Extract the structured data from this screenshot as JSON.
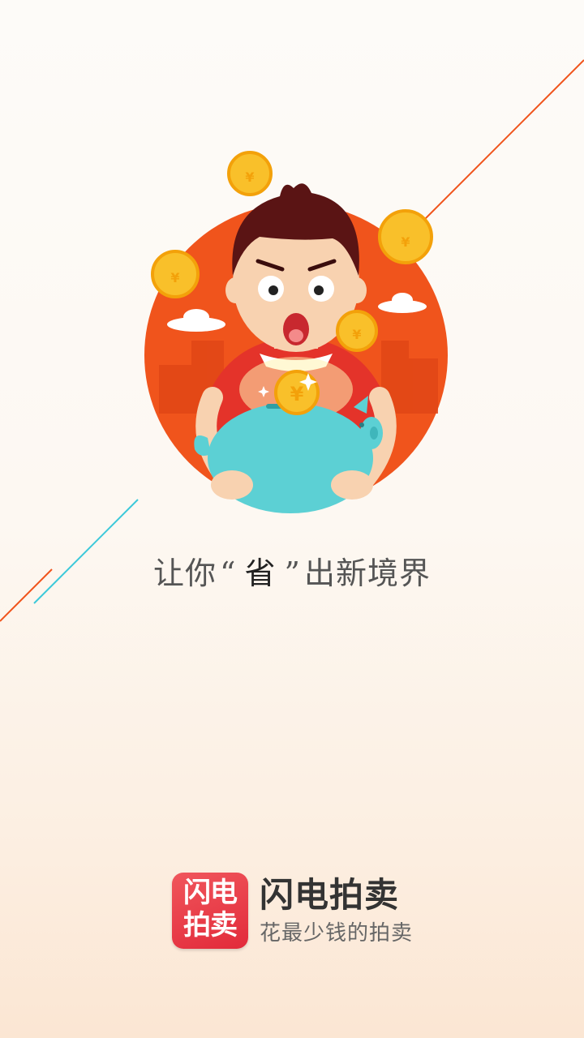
{
  "tagline": {
    "prefix": "让你",
    "open_quote": "“",
    "highlight": "省",
    "close_quote": "”",
    "suffix": "出新境界"
  },
  "brand": {
    "logo_line1": "闪电",
    "logo_line2": "拍卖",
    "name": "闪电拍卖",
    "slogan": "花最少钱的拍卖"
  },
  "illustration": {
    "icon": "piggy-bank-saver-illustration",
    "coin_symbol": "¥"
  },
  "colors": {
    "accent_orange": "#f0541c",
    "line_teal": "#3cc9d9",
    "brand_red": "#e22a3a",
    "coin_gold": "#f9c02a",
    "piggy_teal": "#5cd0d4"
  }
}
